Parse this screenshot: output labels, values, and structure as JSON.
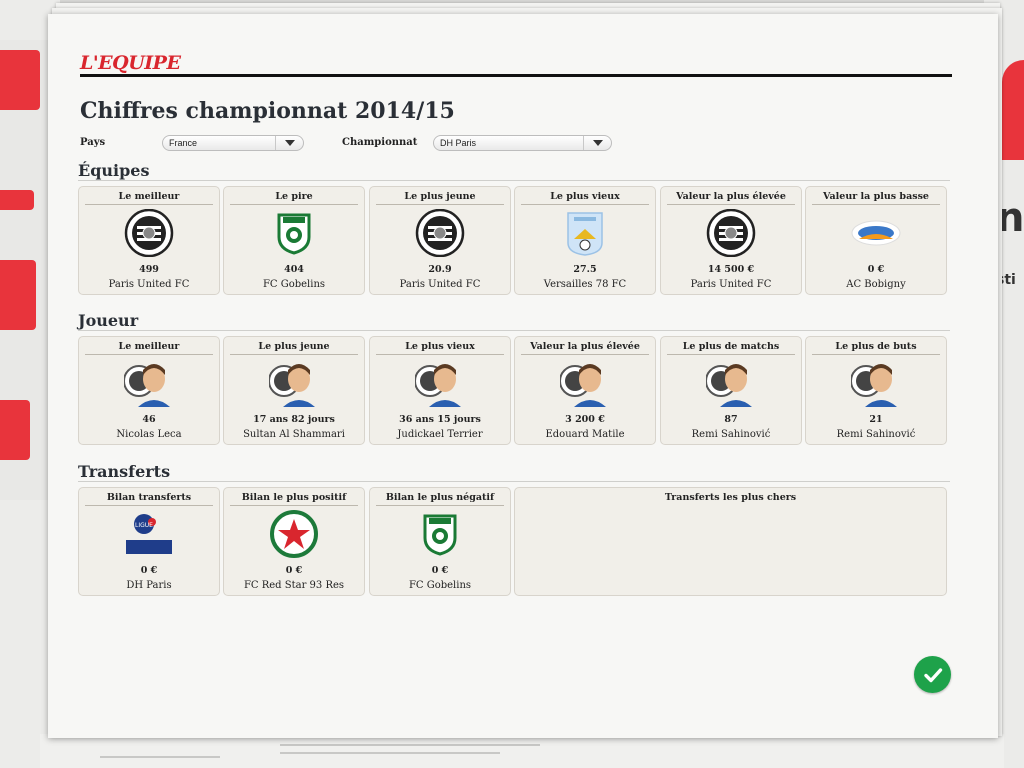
{
  "header": {
    "logo_text": "L'EQUIPE",
    "title": "Chiffres championnat 2014/15"
  },
  "filters": {
    "country_label": "Pays",
    "country_value": "France",
    "league_label": "Championnat",
    "league_value": "DH Paris"
  },
  "sections": {
    "teams_title": "Équipes",
    "players_title": "Joueur",
    "transfers_title": "Transferts"
  },
  "teams": [
    {
      "title": "Le meilleur",
      "value": "499",
      "name": "Paris United FC",
      "icon": "paris-united-crest"
    },
    {
      "title": "Le pire",
      "value": "404",
      "name": "FC Gobelins",
      "icon": "fc-gobelins-crest"
    },
    {
      "title": "Le plus jeune",
      "value": "20.9",
      "name": "Paris United FC",
      "icon": "paris-united-crest"
    },
    {
      "title": "Le plus vieux",
      "value": "27.5",
      "name": "Versailles 78 FC",
      "icon": "versailles-crest"
    },
    {
      "title": "Valeur la plus élevée",
      "value": "14 500 €",
      "name": "Paris United FC",
      "icon": "paris-united-crest"
    },
    {
      "title": "Valeur la plus basse",
      "value": "0 €",
      "name": "AC Bobigny",
      "icon": "ac-bobigny-crest"
    }
  ],
  "players": [
    {
      "title": "Le meilleur",
      "value": "46",
      "name": "Nicolas Leca",
      "icon": "player-portrait"
    },
    {
      "title": "Le plus jeune",
      "value": "17 ans 82 jours",
      "name": "Sultan Al Shammari",
      "icon": "player-portrait"
    },
    {
      "title": "Le plus vieux",
      "value": "36 ans 15 jours",
      "name": "Judickael Terrier",
      "icon": "player-portrait"
    },
    {
      "title": "Valeur la plus élevée",
      "value": "3 200 €",
      "name": "Edouard Matile",
      "icon": "player-portrait"
    },
    {
      "title": "Le plus de matchs",
      "value": "87",
      "name": "Remi Sahinović",
      "icon": "player-portrait"
    },
    {
      "title": "Le plus de buts",
      "value": "21",
      "name": "Remi Sahinović",
      "icon": "player-portrait"
    }
  ],
  "transfers": [
    {
      "title": "Bilan transferts",
      "value": "0 €",
      "name": "DH Paris",
      "icon": "ligue-logo",
      "logo_text": "LIGUE"
    },
    {
      "title": "Bilan le plus positif",
      "value": "0 €",
      "name": "FC Red Star 93 Res",
      "icon": "red-star-crest"
    },
    {
      "title": "Bilan le plus négatif",
      "value": "0 €",
      "name": "FC Gobelins",
      "icon": "fc-gobelins-crest"
    }
  ],
  "transfers_costly_title": "Transferts les plus chers",
  "colors": {
    "brand_red": "#d9262e",
    "ok_green": "#1ea24a",
    "card_bg": "#f1efe9"
  }
}
